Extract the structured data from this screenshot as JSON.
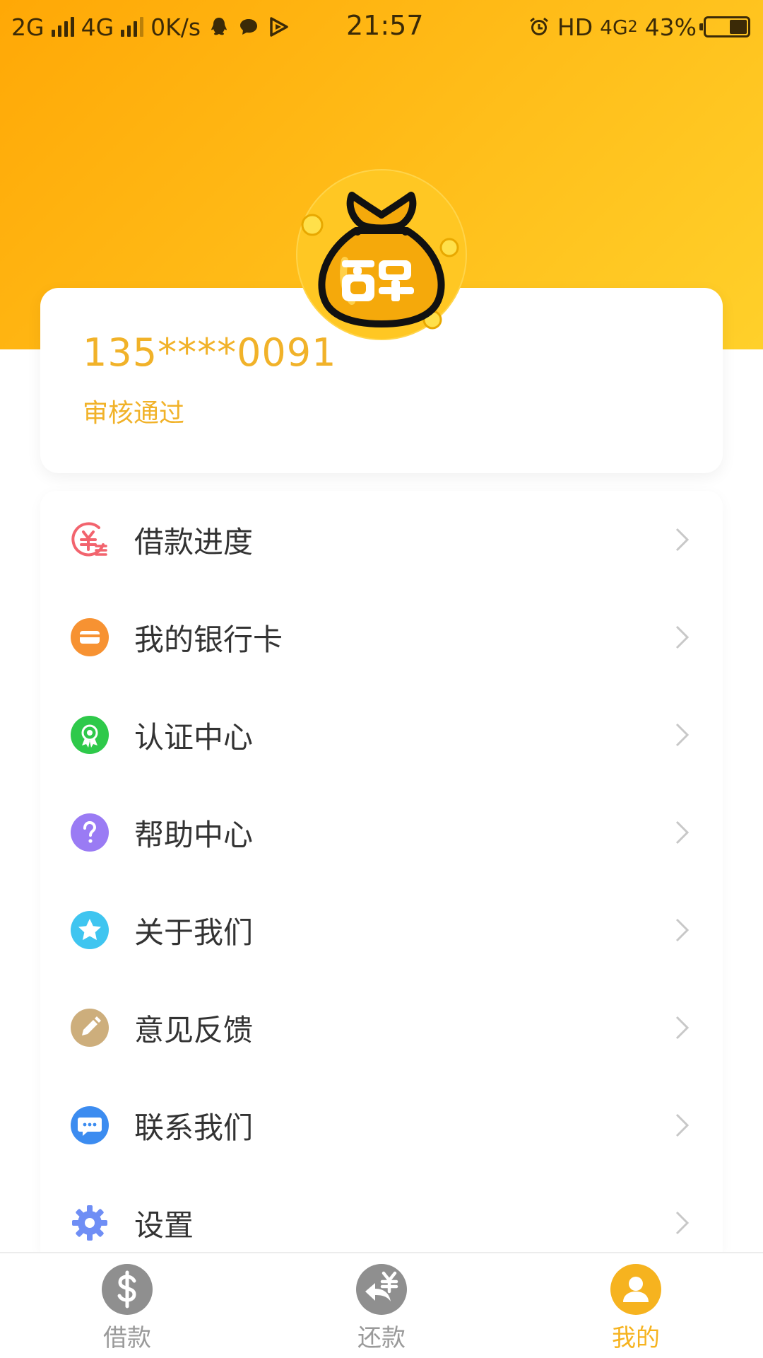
{
  "status_bar": {
    "network1": "2G",
    "network2": "4G",
    "speed": "0K/s",
    "time": "21:57",
    "hd": "HD",
    "network3": "4G",
    "sim": "2",
    "battery": "43%",
    "battery_level": 0.43
  },
  "profile": {
    "phone": "135****0091",
    "status": "审核通过",
    "avatar_icon": "money-bag-icon"
  },
  "menu": {
    "items": [
      {
        "label": "借款进度",
        "icon": "loan-progress-icon",
        "color": "#F2646E"
      },
      {
        "label": "我的银行卡",
        "icon": "bank-card-icon",
        "color": "#F79232"
      },
      {
        "label": "认证中心",
        "icon": "certification-icon",
        "color": "#2EC94A"
      },
      {
        "label": "帮助中心",
        "icon": "help-icon",
        "color": "#9A7BF4"
      },
      {
        "label": "关于我们",
        "icon": "star-icon",
        "color": "#3FC5F0"
      },
      {
        "label": "意见反馈",
        "icon": "pencil-icon",
        "color": "#CDAE7C"
      },
      {
        "label": "联系我们",
        "icon": "chat-icon",
        "color": "#3C8CF0"
      },
      {
        "label": "设置",
        "icon": "gear-icon",
        "color": "#6F8EF5"
      }
    ]
  },
  "nav": {
    "items": [
      {
        "label": "借款",
        "icon": "dollar-icon",
        "active": false
      },
      {
        "label": "还款",
        "icon": "repay-icon",
        "active": false
      },
      {
        "label": "我的",
        "icon": "user-icon",
        "active": true
      }
    ]
  },
  "colors": {
    "brand_yellow": "#FFB50F",
    "accent_text": "#F1B229",
    "nav_active": "#F6B31F",
    "nav_inactive": "#9A9A9A"
  }
}
